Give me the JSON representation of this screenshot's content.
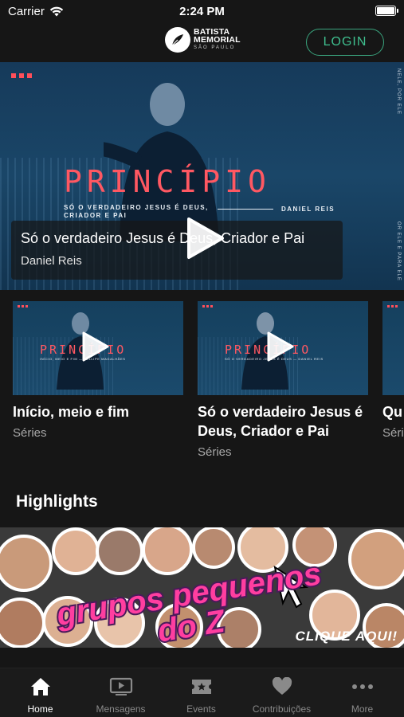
{
  "status_bar": {
    "carrier": "Carrier",
    "time": "2:24 PM"
  },
  "header": {
    "logo": {
      "line1": "BATISTA",
      "line2": "MEMORIAL",
      "line3": "SÃO PAULO"
    },
    "login_label": "LOGIN"
  },
  "hero": {
    "brand_title": "PRINCÍPIO",
    "subtitle": "SÓ O VERDADEIRO JESUS É DEUS, CRIADOR E PAI",
    "author_tag": "DANIEL REIS",
    "side_top": "NELE, POR ELE",
    "side_bottom": "OR ELE E PARA ELE",
    "side_left": "",
    "title": "Só o verdadeiro Jesus é Deus, Criador e Pai",
    "author": "Daniel Reis"
  },
  "cards": [
    {
      "thumb_title": "PRINCÍPIO",
      "thumb_sub": "INÍCIO, MEIO E FIM  —  FELLIPE MAGALHÃES",
      "title": "Início, meio e fim",
      "subtitle": "Séries"
    },
    {
      "thumb_title": "PRINCÍPIO",
      "thumb_sub": "SÓ O VERDADEIRO JESUS É DEUS  —  DANIEL REIS",
      "title": "Só o verdadeiro Jesus é Deus, Criador e Pai",
      "subtitle": "Séries"
    },
    {
      "thumb_title": "",
      "thumb_sub": "",
      "title": "Qu",
      "subtitle": "Séri"
    }
  ],
  "highlights": {
    "title": "Highlights",
    "banner_line1": "grupos pequenos",
    "banner_line2": "do Z",
    "banner_cta": "CLIQUE AQUI!"
  },
  "tabbar": [
    {
      "label": "Home",
      "icon": "home-icon",
      "active": true
    },
    {
      "label": "Mensagens",
      "icon": "video-icon",
      "active": false
    },
    {
      "label": "Events",
      "icon": "ticket-icon",
      "active": false
    },
    {
      "label": "Contribuições",
      "icon": "heart-icon",
      "active": false
    },
    {
      "label": "More",
      "icon": "more-icon",
      "active": false
    }
  ],
  "colors": {
    "accent": "#3fbf8f",
    "brand_red": "#ff5862",
    "hero_blue": "#1a4668",
    "background": "#161616"
  }
}
